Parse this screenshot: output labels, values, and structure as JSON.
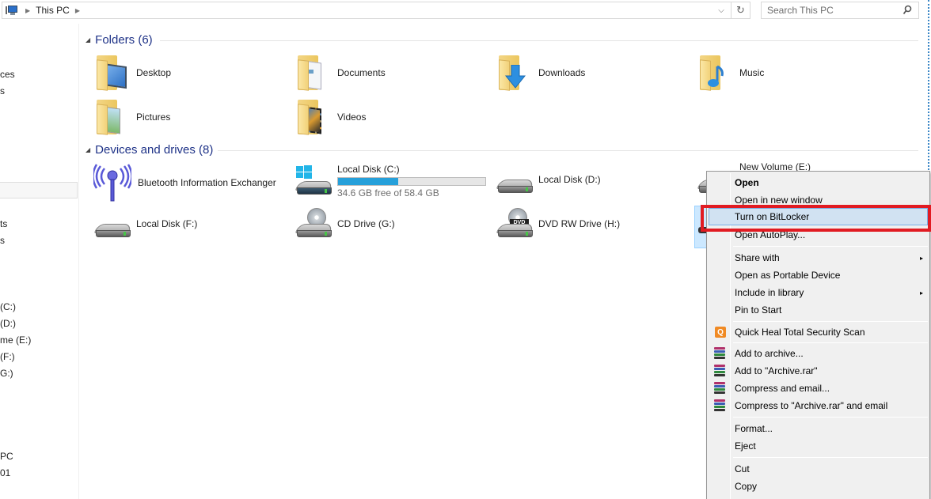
{
  "addressbar": {
    "crumbs": [
      "This PC"
    ],
    "dropdown_icon": "chevron-down-icon",
    "refresh_icon": "refresh-icon"
  },
  "search": {
    "placeholder": "Search This PC",
    "icon": "search-icon"
  },
  "navpane": {
    "items": [
      {
        "label": "ces"
      },
      {
        "label": "s"
      },
      {
        "label": "ts"
      },
      {
        "label": "s"
      },
      {
        "label": "(C:)"
      },
      {
        "label": "(D:)"
      },
      {
        "label": "me (E:)"
      },
      {
        "label": "(F:)"
      },
      {
        "label": "G:)"
      },
      {
        "label": "PC"
      },
      {
        "label": "01"
      }
    ]
  },
  "folders": {
    "header": "Folders (6)",
    "items": [
      {
        "label": "Desktop",
        "icon": "desktop-folder-icon"
      },
      {
        "label": "Documents",
        "icon": "documents-folder-icon"
      },
      {
        "label": "Downloads",
        "icon": "downloads-folder-icon"
      },
      {
        "label": "Music",
        "icon": "music-folder-icon"
      },
      {
        "label": "Pictures",
        "icon": "pictures-folder-icon"
      },
      {
        "label": "Videos",
        "icon": "videos-folder-icon"
      }
    ]
  },
  "devices": {
    "header": "Devices and drives (8)",
    "items": [
      {
        "label": "Bluetooth Information Exchanger",
        "icon": "bluetooth-antenna-icon"
      },
      {
        "label": "Local Disk (C:)",
        "icon": "windows-drive-icon",
        "free_text": "34.6 GB free of 58.4 GB",
        "used_fraction": 0.408,
        "bar_color": "#26a0da"
      },
      {
        "label": "Local Disk (D:)",
        "icon": "hard-drive-icon"
      },
      {
        "label": "New Volume (E:)",
        "icon": "hard-drive-icon"
      },
      {
        "label": "Local Disk (F:)",
        "icon": "hard-drive-icon"
      },
      {
        "label": "CD Drive (G:)",
        "icon": "cd-drive-icon"
      },
      {
        "label": "DVD RW Drive (H:)",
        "icon": "dvd-drive-icon",
        "badge": "DVD"
      },
      {
        "label": "",
        "icon": "removable-drive-icon",
        "selected": true
      }
    ]
  },
  "context_menu": {
    "items": [
      {
        "label": "Open",
        "bold": true
      },
      {
        "label": "Open in new window"
      },
      {
        "label": "Turn on BitLocker",
        "hover": true,
        "highlighted": true
      },
      {
        "label": "Open AutoPlay..."
      },
      {
        "label": "Share with",
        "submenu": true
      },
      {
        "label": "Open as Portable Device"
      },
      {
        "label": "Include in library",
        "submenu": true
      },
      {
        "label": "Pin to Start"
      },
      {
        "label": "Quick Heal Total Security Scan",
        "icon": "quick-heal-icon",
        "icon_glyph": "Q"
      },
      {
        "label": "Add to archive...",
        "icon": "winrar-icon"
      },
      {
        "label": "Add to \"Archive.rar\"",
        "icon": "winrar-icon"
      },
      {
        "label": "Compress and email...",
        "icon": "winrar-icon"
      },
      {
        "label": "Compress to \"Archive.rar\" and email",
        "icon": "winrar-icon"
      },
      {
        "label": "Format..."
      },
      {
        "label": "Eject"
      },
      {
        "label": "Cut"
      },
      {
        "label": "Copy"
      }
    ],
    "submenu_arrow": "▸",
    "highlight_color": "#e11b22"
  },
  "colors": {
    "accent": "#26a0da",
    "header_text": "#1e3287",
    "selection": "#cce8ff"
  }
}
